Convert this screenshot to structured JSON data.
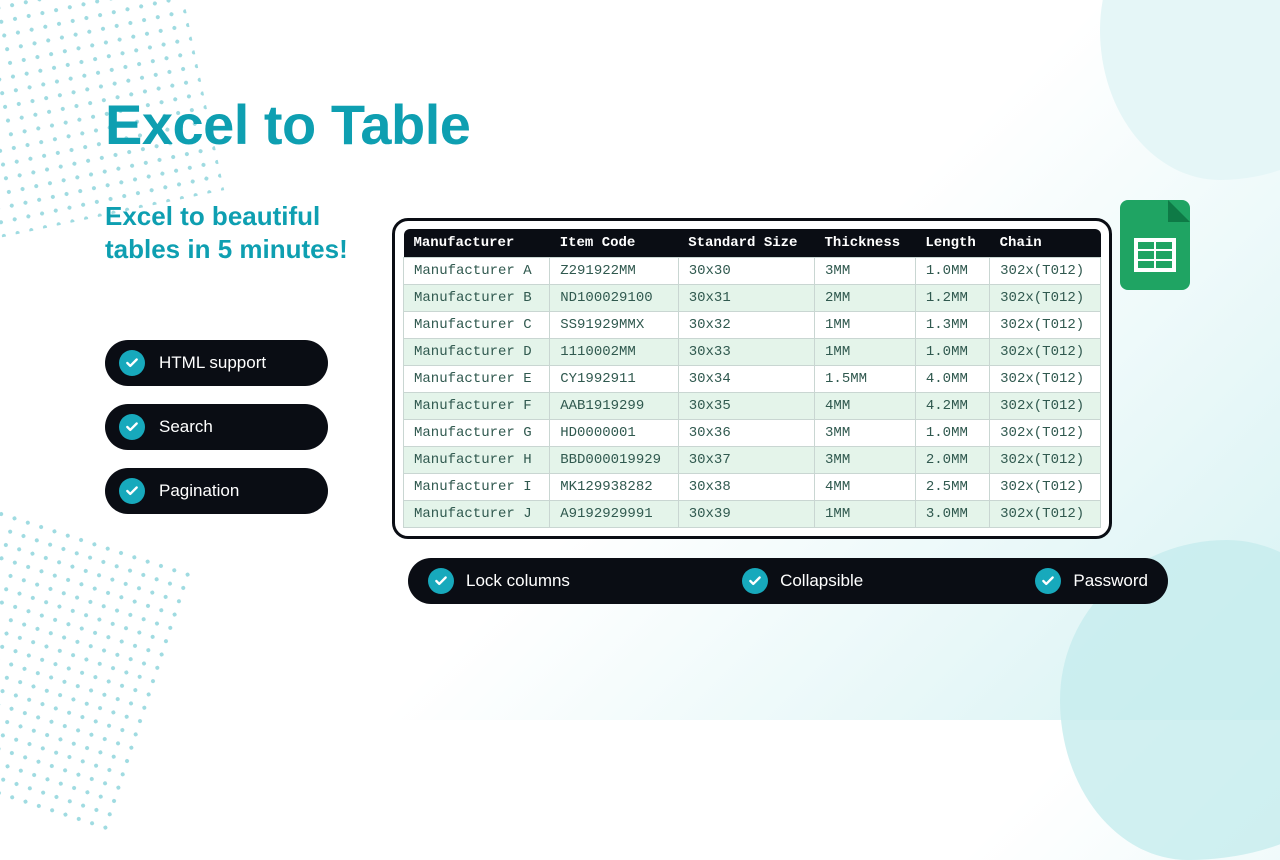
{
  "title": "Excel to Table",
  "subtitle": "Excel to beautiful tables in 5 minutes!",
  "features_side": [
    "HTML support",
    "Search",
    "Pagination"
  ],
  "features_bottom": [
    "Lock columns",
    "Collapsible",
    "Password"
  ],
  "table": {
    "headers": [
      "Manufacturer",
      "Item Code",
      "Standard Size",
      "Thickness",
      "Length",
      "Chain"
    ],
    "rows": [
      [
        "Manufacturer A",
        "Z291922MM",
        "30x30",
        "3MM",
        "1.0MM",
        "302x(T012)"
      ],
      [
        "Manufacturer B",
        "ND100029100",
        "30x31",
        "2MM",
        "1.2MM",
        "302x(T012)"
      ],
      [
        "Manufacturer C",
        "SS91929MMX",
        "30x32",
        "1MM",
        "1.3MM",
        "302x(T012)"
      ],
      [
        "Manufacturer D",
        "1110002MM",
        "30x33",
        "1MM",
        "1.0MM",
        "302x(T012)"
      ],
      [
        "Manufacturer E",
        "CY1992911",
        "30x34",
        "1.5MM",
        "4.0MM",
        "302x(T012)"
      ],
      [
        "Manufacturer F",
        "AAB1919299",
        "30x35",
        "4MM",
        "4.2MM",
        "302x(T012)"
      ],
      [
        "Manufacturer G",
        "HD0000001",
        "30x36",
        "3MM",
        "1.0MM",
        "302x(T012)"
      ],
      [
        "Manufacturer H",
        "BBD000019929",
        "30x37",
        "3MM",
        "2.0MM",
        "302x(T012)"
      ],
      [
        "Manufacturer I",
        "MK129938282",
        "30x38",
        "4MM",
        "2.5MM",
        "302x(T012)"
      ],
      [
        "Manufacturer J",
        "A9192929991",
        "30x39",
        "1MM",
        "3.0MM",
        "302x(T012)"
      ]
    ]
  }
}
